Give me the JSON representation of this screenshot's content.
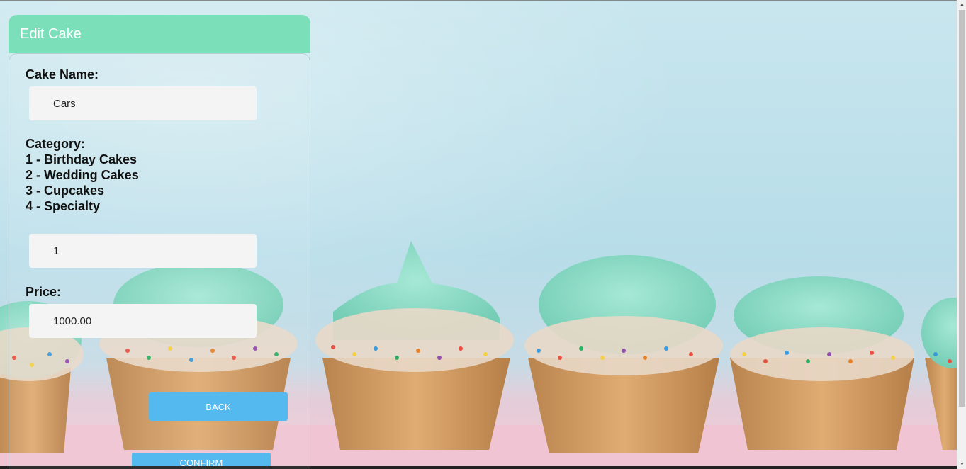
{
  "card": {
    "title": "Edit Cake"
  },
  "form": {
    "cake_name_label": "Cake Name:",
    "cake_name_value": "Cars",
    "category_label": "Category:",
    "category_options": [
      "1 - Birthday Cakes",
      "2 - Wedding Cakes",
      "3 - Cupcakes",
      "4 - Specialty"
    ],
    "category_value": "1",
    "price_label": "Price:",
    "price_value": "1000.00"
  },
  "buttons": {
    "back": "BACK",
    "confirm": "CONFIRM"
  },
  "colors": {
    "header": "#7bdfb9",
    "button": "#53b9ee",
    "frosting": "#8fdcc7"
  }
}
